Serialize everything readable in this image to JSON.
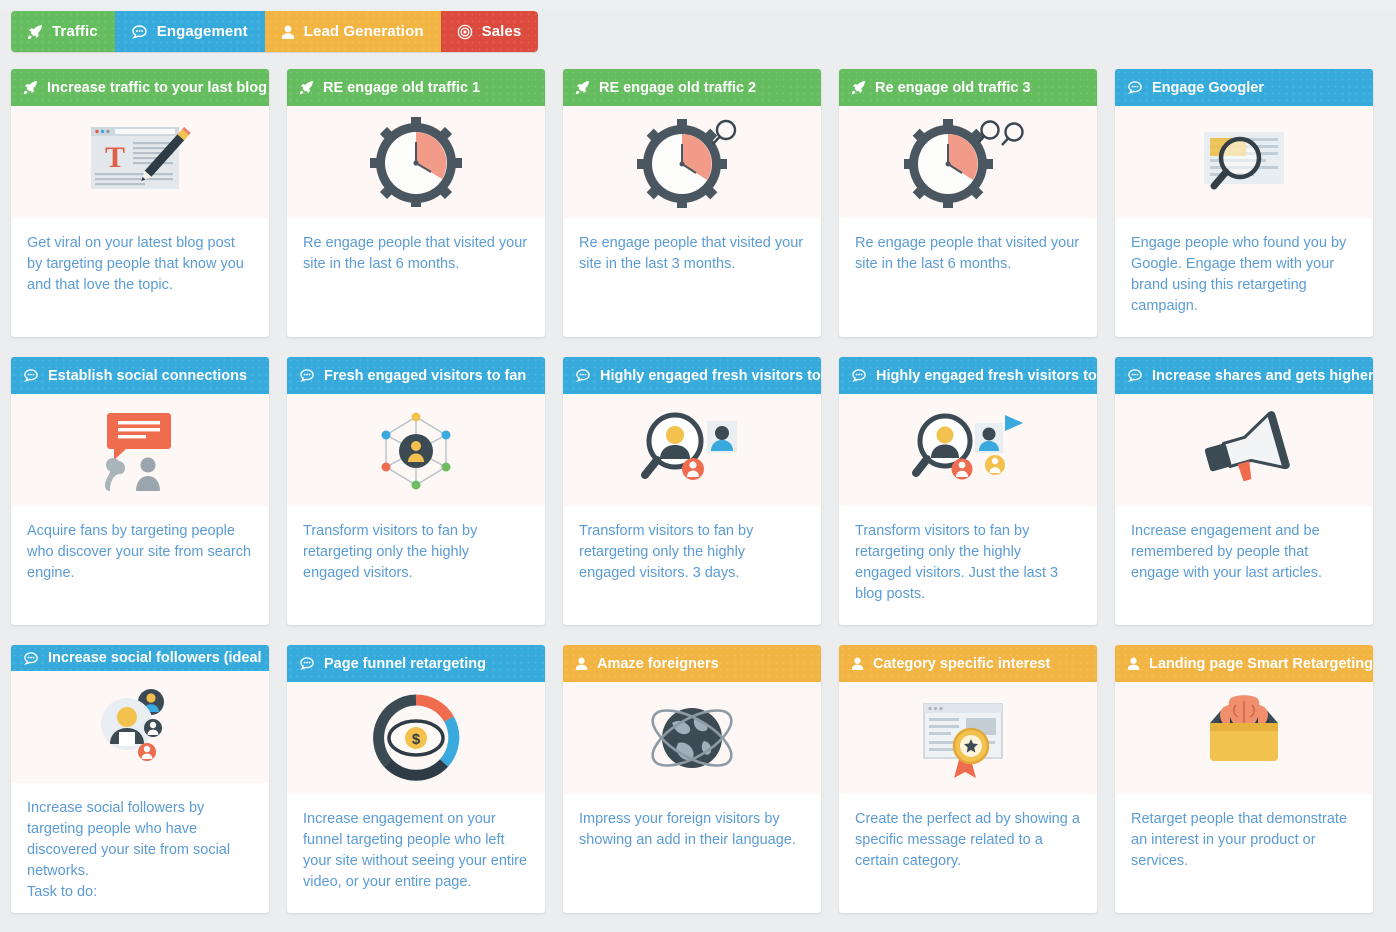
{
  "tabs": [
    {
      "label": "Traffic",
      "icon": "rocket-icon",
      "color": "#66bd60",
      "active": true
    },
    {
      "label": "Engagement",
      "icon": "comment-icon",
      "color": "#37aadc",
      "active": false
    },
    {
      "label": "Lead Generation",
      "icon": "user-icon",
      "color": "#f2b544",
      "active": false
    },
    {
      "label": "Sales",
      "icon": "bullseye-icon",
      "color": "#dc4b3e",
      "active": false
    }
  ],
  "cards": [
    {
      "title": "Increase traffic to your last blog",
      "icon": "rocket-icon",
      "header_color": "#66bd60",
      "art": "blog-post-pencil-illustration",
      "description": "Get viral on your latest blog post by targeting people that know you and that love the topic."
    },
    {
      "title": "RE engage old traffic 1",
      "icon": "rocket-icon",
      "header_color": "#66bd60",
      "art": "clock-gear-illustration",
      "description": "Re engage people that visited your site in the last 6 months."
    },
    {
      "title": "RE engage old traffic 2",
      "icon": "rocket-icon",
      "header_color": "#66bd60",
      "art": "clock-gear-magnifier-illustration",
      "description": "Re engage people that visited your site in the last 3 months."
    },
    {
      "title": "Re engage old traffic 3",
      "icon": "rocket-icon",
      "header_color": "#66bd60",
      "art": "clock-gear-double-magnifier-illustration",
      "description": "Re engage people that visited your site in the last 6 months."
    },
    {
      "title": "Engage Googler",
      "icon": "comment-icon",
      "header_color": "#37aadc",
      "art": "document-magnifier-illustration",
      "description": "Engage people who found you by Google. Engage them with your brand using this retargeting campaign."
    },
    {
      "title": "Establish social connections",
      "icon": "comment-icon",
      "header_color": "#37aadc",
      "art": "chat-bubble-heads-illustration",
      "description": "Acquire fans by targeting people who discover your site from search engine."
    },
    {
      "title": "Fresh engaged visitors to fan",
      "icon": "comment-icon",
      "header_color": "#37aadc",
      "art": "network-user-illustration",
      "description": "Transform visitors to fan by retargeting only the highly engaged visitors."
    },
    {
      "title": "Highly engaged fresh visitors to",
      "icon": "comment-icon",
      "header_color": "#37aadc",
      "art": "user-search-illustration",
      "description": "Transform visitors to fan by retargeting only the highly engaged visitors. 3 days."
    },
    {
      "title": "Highly engaged fresh visitors to",
      "icon": "comment-icon",
      "header_color": "#37aadc",
      "art": "user-search-megaphone-illustration",
      "description": "Transform visitors to fan by retargeting only the highly engaged visitors. Just the last 3 blog posts."
    },
    {
      "title": "Increase shares and gets higher",
      "icon": "comment-icon",
      "header_color": "#37aadc",
      "art": "megaphone-illustration",
      "description": "Increase engagement and be remembered by people that engage with your last articles."
    },
    {
      "title": "Increase social followers (ideal",
      "icon": "comment-icon",
      "header_color": "#37aadc",
      "art": "add-user-group-illustration",
      "description": "Increase social followers by targeting people who have discovered your site from social networks.\nTask to do:"
    },
    {
      "title": "Page funnel retargeting",
      "icon": "comment-icon",
      "header_color": "#37aadc",
      "art": "funnel-eye-dollar-illustration",
      "description": "Increase engagement on your funnel targeting people who left your site without seeing your entire video, or your entire page."
    },
    {
      "title": "Amaze foreigners",
      "icon": "user-icon",
      "header_color": "#f2b544",
      "art": "globe-orbit-illustration",
      "description": "Impress your foreign visitors by showing an add in their language."
    },
    {
      "title": "Category specific interest",
      "icon": "user-icon",
      "header_color": "#f2b544",
      "art": "browser-award-ribbon-illustration",
      "description": "Create the perfect ad by showing a specific message related to a certain category."
    },
    {
      "title": "Landing page Smart Retargeting",
      "icon": "user-icon",
      "header_color": "#f2b544",
      "art": "brain-box-illustration",
      "description": "Retarget people that demonstrate an interest in your product or services."
    }
  ]
}
